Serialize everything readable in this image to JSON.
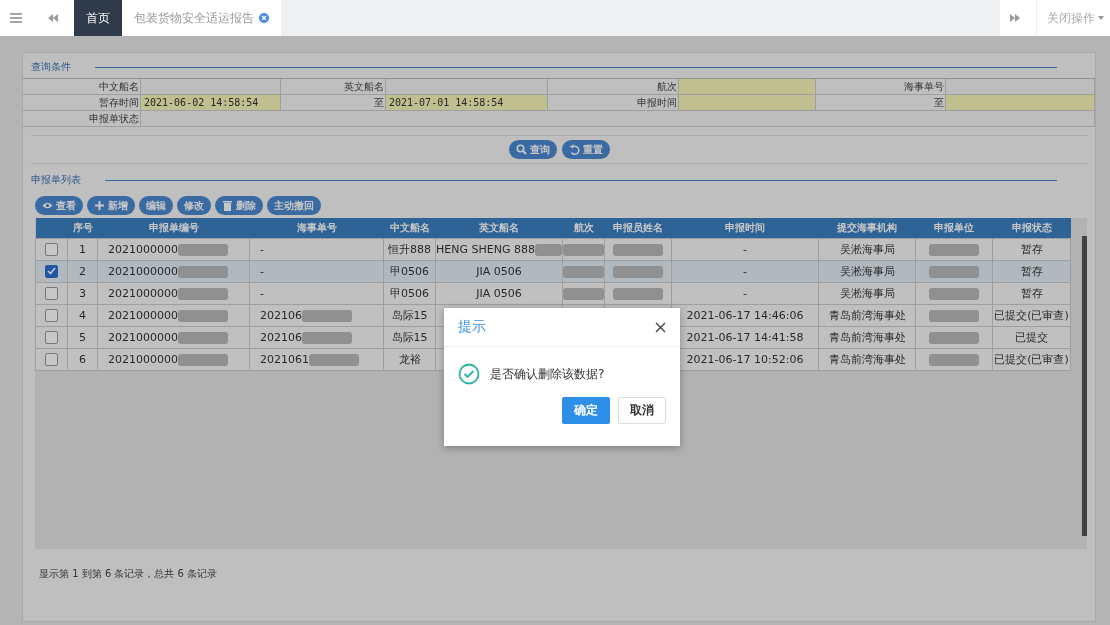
{
  "topbar": {
    "tabs": [
      {
        "label": "首页",
        "selected": true,
        "closable": false
      },
      {
        "label": "包装货物安全适运报告",
        "selected": false,
        "closable": true
      }
    ],
    "close_menu": "关闭操作"
  },
  "query": {
    "title": "查询条件",
    "rows": [
      [
        {
          "label": "中文船名",
          "highlighted": false
        },
        {
          "label": "英文船名",
          "highlighted": false
        },
        {
          "label": "航次",
          "highlighted": true
        },
        {
          "label": "海事单号",
          "highlighted": false
        }
      ],
      [
        {
          "label": "暂存时间",
          "value": "2021-06-02 14:58:54",
          "highlighted": true
        },
        {
          "label": "至",
          "value": "2021-07-01 14:58:54",
          "highlighted": true
        },
        {
          "label": "申报时间",
          "highlighted": true
        },
        {
          "label": "至",
          "highlighted": true
        }
      ],
      [
        {
          "label": "申报单状态",
          "highlighted": false
        }
      ]
    ],
    "buttons": [
      {
        "label": "查询",
        "kind": "search"
      },
      {
        "label": "重置",
        "kind": "reset"
      }
    ]
  },
  "list": {
    "title": "申报单列表",
    "toolbar": [
      {
        "label": "查看",
        "kind": "view"
      },
      {
        "label": "新增",
        "kind": "add"
      },
      {
        "label": "编辑",
        "kind": "plain"
      },
      {
        "label": "修改",
        "kind": "plain"
      },
      {
        "label": "删除",
        "kind": "delete"
      },
      {
        "label": "主动撤回",
        "kind": "plain"
      }
    ],
    "columns": [
      "序号",
      "申报单编号",
      "海事单号",
      "中文船名",
      "英文船名",
      "航次",
      "申报员姓名",
      "申报时间",
      "提交海事机构",
      "申报单位",
      "申报状态"
    ],
    "rows": [
      {
        "checked": false,
        "selected": false,
        "cells": [
          "1",
          {
            "text": "2021000000",
            "blurred": true
          },
          "-",
          "恒升888",
          {
            "text": "HENG SHENG 888",
            "blurred": true
          },
          {
            "blurred": true
          },
          {
            "blurred": true
          },
          "-",
          "吴淞海事局",
          {
            "blurred": true
          },
          "暂存"
        ]
      },
      {
        "checked": true,
        "selected": true,
        "cells": [
          "2",
          {
            "text": "2021000000",
            "blurred": true
          },
          "-",
          "甲0506",
          "JIA 0506",
          {
            "blurred": true
          },
          {
            "blurred": true
          },
          "-",
          "吴淞海事局",
          {
            "blurred": true
          },
          "暂存"
        ]
      },
      {
        "checked": false,
        "selected": false,
        "cells": [
          "3",
          {
            "text": "2021000000",
            "blurred": true
          },
          "-",
          "甲0506",
          "JIA 0506",
          {
            "blurred": true
          },
          {
            "blurred": true
          },
          "-",
          "吴淞海事局",
          {
            "blurred": true
          },
          "暂存"
        ]
      },
      {
        "checked": false,
        "selected": false,
        "cells": [
          "4",
          {
            "text": "2021000000",
            "blurred": true
          },
          {
            "text": "202106",
            "blurred": true
          },
          "岛际15",
          null,
          null,
          null,
          "2021-06-17 14:46:06",
          "青岛前湾海事处",
          {
            "blurred": true
          },
          "已提交(已审查)"
        ]
      },
      {
        "checked": false,
        "selected": false,
        "cells": [
          "5",
          {
            "text": "2021000000",
            "blurred": true
          },
          {
            "text": "202106",
            "blurred": true
          },
          "岛际15",
          null,
          null,
          null,
          "2021-06-17 14:41:58",
          "青岛前湾海事处",
          {
            "blurred": true
          },
          "已提交"
        ]
      },
      {
        "checked": false,
        "selected": false,
        "cells": [
          "6",
          {
            "text": "2021000000",
            "blurred": true
          },
          {
            "text": "2021061",
            "blurred": true
          },
          "龙裕",
          null,
          null,
          null,
          "2021-06-17 10:52:06",
          "青岛前湾海事处",
          {
            "blurred": true
          },
          "已提交(已审查)"
        ]
      }
    ],
    "footer": "显示第 1 到第 6 条记录，总共 6 条记录"
  },
  "dialog": {
    "title": "提示",
    "message": "是否确认删除该数据?",
    "buttons": [
      {
        "label": "确定",
        "primary": true
      },
      {
        "label": "取消",
        "primary": false
      }
    ]
  }
}
